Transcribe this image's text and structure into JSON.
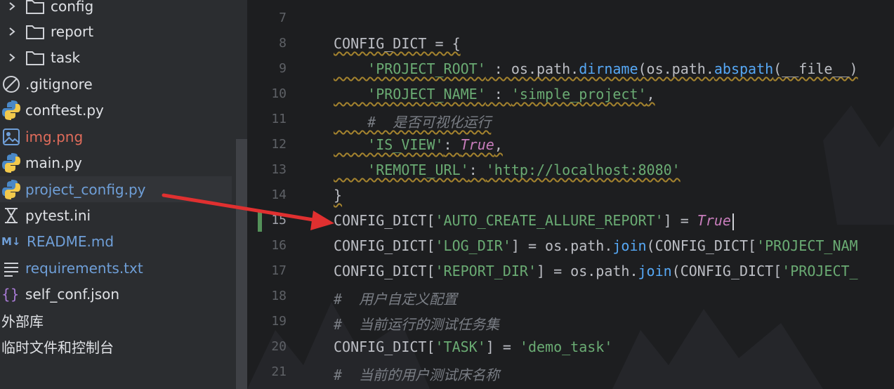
{
  "project_tree": {
    "items": [
      {
        "label": "config",
        "type": "folder"
      },
      {
        "label": "report",
        "type": "folder"
      },
      {
        "label": "task",
        "type": "folder"
      },
      {
        "label": ".gitignore",
        "type": "ignore-file"
      },
      {
        "label": "conftest.py",
        "type": "python-file"
      },
      {
        "label": "img.png",
        "type": "image-file"
      },
      {
        "label": "main.py",
        "type": "python-file"
      },
      {
        "label": "project_config.py",
        "type": "python-file"
      },
      {
        "label": "pytest.ini",
        "type": "ini-file"
      },
      {
        "label": "README.md",
        "type": "markdown-file"
      },
      {
        "label": "requirements.txt",
        "type": "text-file"
      },
      {
        "label": "self_conf.json",
        "type": "json-file"
      },
      {
        "label": "外部库",
        "type": "external-libraries"
      },
      {
        "label": "临时文件和控制台",
        "type": "scratches"
      }
    ]
  },
  "editor": {
    "line_numbers": [
      "7",
      "8",
      "9",
      "10",
      "11",
      "12",
      "13",
      "14",
      "15",
      "16",
      "17",
      "18",
      "19",
      "20",
      "21"
    ],
    "lines": {
      "l8": "CONFIG_DICT = {",
      "l9a": "    'PROJECT_ROOT'",
      "l9b": " : os.path.",
      "l9c": "dirname",
      "l9d": "(os.path.",
      "l9e": "abspath",
      "l9f": "(__file__)",
      "l10a": "    'PROJECT_NAME'",
      "l10b": " : ",
      "l10c": "'simple_project'",
      "l10d": ",",
      "l11": "    #  是否可视化运行",
      "l12a": "    'IS_VIEW'",
      "l12b": ": ",
      "l12c": "True",
      "l12d": ",",
      "l13a": "    'REMOTE_URL'",
      "l13b": ": ",
      "l13c": "'http://localhost:8080'",
      "l14": "}",
      "l15a": "CONFIG_DICT[",
      "l15b": "'AUTO_CREATE_ALLURE_REPORT'",
      "l15c": "] = ",
      "l15d": "True",
      "l16a": "CONFIG_DICT[",
      "l16b": "'LOG_DIR'",
      "l16c": "] = os.path.",
      "l16d": "join",
      "l16e": "(CONFIG_DICT[",
      "l16f": "'PROJECT_NAM",
      "l17a": "CONFIG_DICT[",
      "l17b": "'REPORT_DIR'",
      "l17c": "] = os.path.",
      "l17d": "join",
      "l17e": "(CONFIG_DICT[",
      "l17f": "'PROJECT_",
      "l18": "#  用户自定义配置",
      "l19": "#  当前运行的测试任务集",
      "l20a": "CONFIG_DICT[",
      "l20b": "'TASK'",
      "l20c": "] = ",
      "l20d": "'demo_task'",
      "l21": "#  当前的用户测试床名称"
    }
  },
  "colors": {
    "sidebar_bg": "#2b2d30",
    "editor_bg": "#1d1e20",
    "string": "#6aab73",
    "keyword": "#c77dbb",
    "function": "#56a8f5",
    "comment": "#7a7e85",
    "arrow": "#e03030",
    "image_file": "#e06c5b",
    "modified_file": "#6f9fd8"
  }
}
